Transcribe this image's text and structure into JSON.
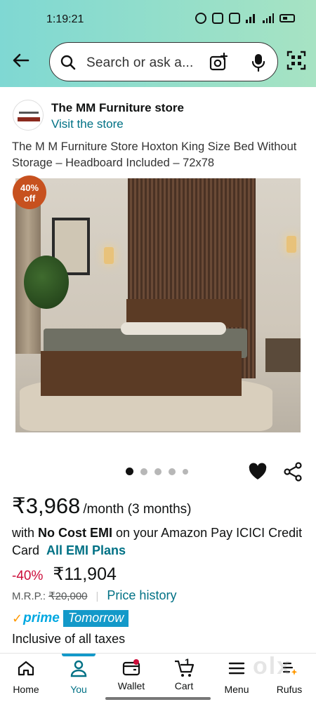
{
  "status_bar": {
    "time": "1:19:21"
  },
  "search": {
    "placeholder": "Search or ask a..."
  },
  "store": {
    "name": "The MM Furniture store",
    "link": "Visit the store"
  },
  "product": {
    "title": "The M M Furniture Store Hoxton King Size Bed Without Storage – Headboard Included – 72x78",
    "discount_badge": {
      "line1": "40%",
      "line2": "off"
    }
  },
  "gallery": {
    "total": 5,
    "active": 0
  },
  "price": {
    "emi_price": "₹3,968",
    "emi_suffix": "/month (3 months)",
    "emi_prefix": "with ",
    "emi_bold": "No Cost EMI",
    "emi_rest": " on your Amazon Pay ICICI Credit Card",
    "emi_link": "All EMI Plans",
    "discount_pct": "-40%",
    "sale_price": "₹11,904",
    "mrp_label": "M.R.P.:",
    "mrp_value": "₹20,000",
    "price_history": "Price history"
  },
  "delivery": {
    "prime_check": "✓",
    "prime": "prime",
    "tag": "Tomorrow"
  },
  "tax": "Inclusive of all taxes",
  "bottom_nav": {
    "items": [
      {
        "label": "Home"
      },
      {
        "label": "You"
      },
      {
        "label": "Wallet"
      },
      {
        "label": "Cart",
        "badge": "1"
      },
      {
        "label": "Menu"
      },
      {
        "label": "Rufus"
      }
    ],
    "active": "You"
  },
  "watermark": "olx",
  "colors": {
    "accent": "#007185",
    "discount": "#cc0c39",
    "prime": "#1399c9",
    "badge": "#c7511f"
  }
}
